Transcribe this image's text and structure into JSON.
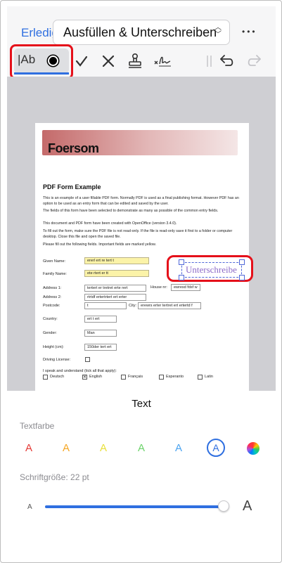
{
  "nav": {
    "done_label": "Erledigt",
    "mode_title": "Ausfüllen & Unterschreiben",
    "more_label": "•••"
  },
  "toolbar": {
    "text_tool_label": "|Ab",
    "tools": [
      "dot-icon",
      "checkmark-icon",
      "cross-icon",
      "stamp-icon",
      "signature-icon",
      "divider-icon",
      "undo-icon",
      "redo-icon"
    ]
  },
  "document": {
    "banner_title": "Foersom",
    "title": "PDF Form Example",
    "paragraphs": [
      "This is an example of a user fillable PDF form. Normally PDF is used as a final publishing format. However PDF has an option to be used as an entry form that can be edited and saved by the user.",
      "The fields of this form have been selected to demonstrate as many as possible of the common entry fields.",
      "This document and PDF form have been created with OpenOffice (version 3.4.0).",
      "To fill out the form, make sure the PDF file is not read-only. If the file is read-only save it first to a folder or computer desktop. Close this file and open the saved file.",
      "Please fill out the following fields. Important fields are marked yellow."
    ],
    "fields": {
      "given_name_label": "Given Name:",
      "given_name_value": "ererl ert re tert t",
      "family_name_label": "Family Name:",
      "family_name_value": "ete rtert er tt",
      "address1_label": "Address 1:",
      "address1_value": "tertert er tretret  erte rert",
      "house_label": "House nr:",
      "house_value": "ewresd fdsf w",
      "address2_label": "Address 2:",
      "address2_value": "rtrtdf ertertrtert ert erter",
      "postcode_label": "Postcode:",
      "postcode_value": "t",
      "city_label": "City:",
      "city_value": "erewrs erter tertret ert ertertd f",
      "country_label": "Country:",
      "country_value": "ert t ert",
      "gender_label": "Gender:",
      "gender_value": "Man",
      "height_label": "Height (cm):",
      "height_value": "150der tert ert",
      "license_label": "Driving License:",
      "languages_label": "I speak and understand (tick all that apply):",
      "languages": [
        "Deutsch",
        "English",
        "Français",
        "Esperanto",
        "Latin"
      ],
      "languages_checked": [
        false,
        true,
        false,
        false,
        false
      ]
    },
    "signature_placeholder": "Unterschreibe"
  },
  "panel": {
    "title": "Text",
    "color_label": "Textfarbe",
    "swatch_letter": "A",
    "colors": [
      "#e53935",
      "#f5a623",
      "#e8e03a",
      "#6cd36a",
      "#4aa3f0"
    ],
    "selected_color": "#2f6fe0",
    "font_size_label": "Schriftgröße: 22 pt",
    "font_size_pt": 22,
    "slider_fraction": 0.95,
    "slider_min_label": "A",
    "slider_max_label": "A"
  }
}
